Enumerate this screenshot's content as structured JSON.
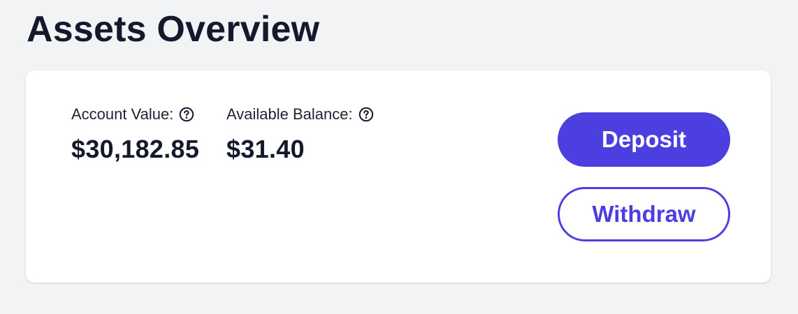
{
  "header": {
    "title": "Assets Overview"
  },
  "overview": {
    "account_value": {
      "label": "Account Value:",
      "value": "$30,182.85",
      "help_icon": "question-circle-icon"
    },
    "available_balance": {
      "label": "Available Balance:",
      "value": "$31.40",
      "help_icon": "question-circle-icon"
    }
  },
  "actions": {
    "deposit_label": "Deposit",
    "withdraw_label": "Withdraw"
  },
  "colors": {
    "accent": "#4b3fe0",
    "background": "#f2f3f5",
    "card": "#ffffff",
    "text": "#141a2b"
  }
}
